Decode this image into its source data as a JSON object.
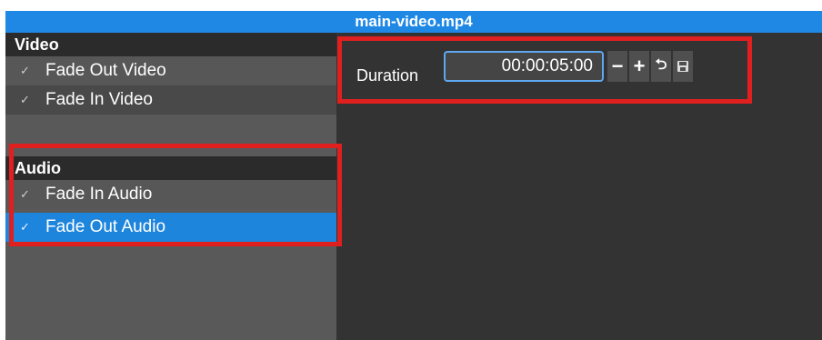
{
  "window": {
    "title": "main-video.mp4"
  },
  "sidebar": {
    "groups": [
      {
        "label": "Video",
        "items": [
          {
            "label": "Fade Out Video"
          },
          {
            "label": "Fade In Video"
          }
        ]
      },
      {
        "label": "Audio",
        "items": [
          {
            "label": "Fade In Audio"
          },
          {
            "label": "Fade Out Audio",
            "selected": true
          }
        ]
      }
    ]
  },
  "properties": {
    "duration": {
      "label": "Duration",
      "value": "00:00:05:00",
      "buttons": [
        "minus-icon",
        "plus-icon",
        "undo-icon",
        "save-icon"
      ]
    }
  },
  "colors": {
    "accent": "#1e85dc",
    "highlight": "#e01f1f",
    "panel": "#333333",
    "sidebar": "#595959"
  }
}
